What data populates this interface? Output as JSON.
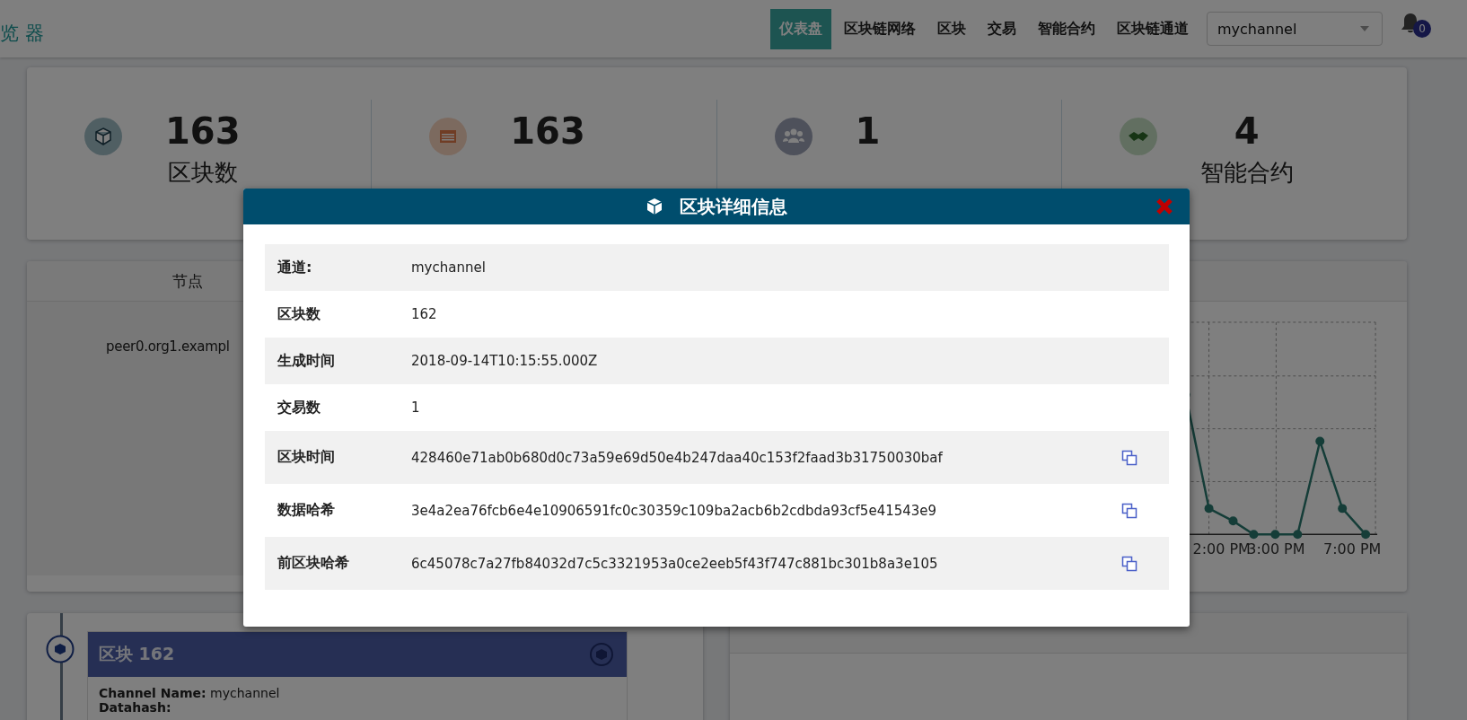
{
  "header": {
    "title_fragment": "览 器",
    "nav": [
      {
        "label": "仪表盘",
        "selected": true
      },
      {
        "label": "区块链网络",
        "selected": false
      },
      {
        "label": "区块",
        "selected": false
      },
      {
        "label": "交易",
        "selected": false
      },
      {
        "label": "智能合约",
        "selected": false
      },
      {
        "label": "区块链通道",
        "selected": false
      }
    ],
    "channel_select": {
      "value": "mychannel"
    },
    "notifications": {
      "count": "0"
    }
  },
  "stats": [
    {
      "kind": "block",
      "value": "163",
      "label": "区块数"
    },
    {
      "kind": "transaction",
      "value": "163"
    },
    {
      "kind": "node",
      "value": "1"
    },
    {
      "kind": "contract",
      "value": "4",
      "label": "智能合约"
    }
  ],
  "peers_panel": {
    "title": "节点",
    "rows": [
      "peer0.org1.exampl"
    ]
  },
  "chart_panel": {
    "x_labels": [
      "2:00 PM",
      "3:00 PM",
      "7:00 PM"
    ]
  },
  "block_list": [
    {
      "title": "区块 162",
      "channel_label": "Channel Name:",
      "channel": "mychannel",
      "datahash_label": "Datahash:"
    }
  ],
  "modal": {
    "title": "区块详细信息",
    "rows": [
      {
        "label": "通道:",
        "value": "mychannel",
        "copyable": false
      },
      {
        "label": "区块数",
        "value": "162",
        "copyable": false
      },
      {
        "label": "生成时间",
        "value": "2018-09-14T10:15:55.000Z",
        "copyable": false
      },
      {
        "label": "交易数",
        "value": "1",
        "copyable": false
      },
      {
        "label": "区块时间",
        "value": "428460e71ab0b680d0c73a59e69d50e4b247daa40c153f2faad3b31750030baf",
        "copyable": true
      },
      {
        "label": "数据哈希",
        "value": "3e4a2ea76fcb6e4e10906591fc0c30359c109ba2acb6b2cdbda93cf5e41543e9",
        "copyable": true
      },
      {
        "label": "前区块哈希",
        "value": "6c45078c7a27fb84032d7c5c3321953a0ce2eeb5f43f747c881bc301b8a3e105",
        "copyable": true
      }
    ]
  }
}
